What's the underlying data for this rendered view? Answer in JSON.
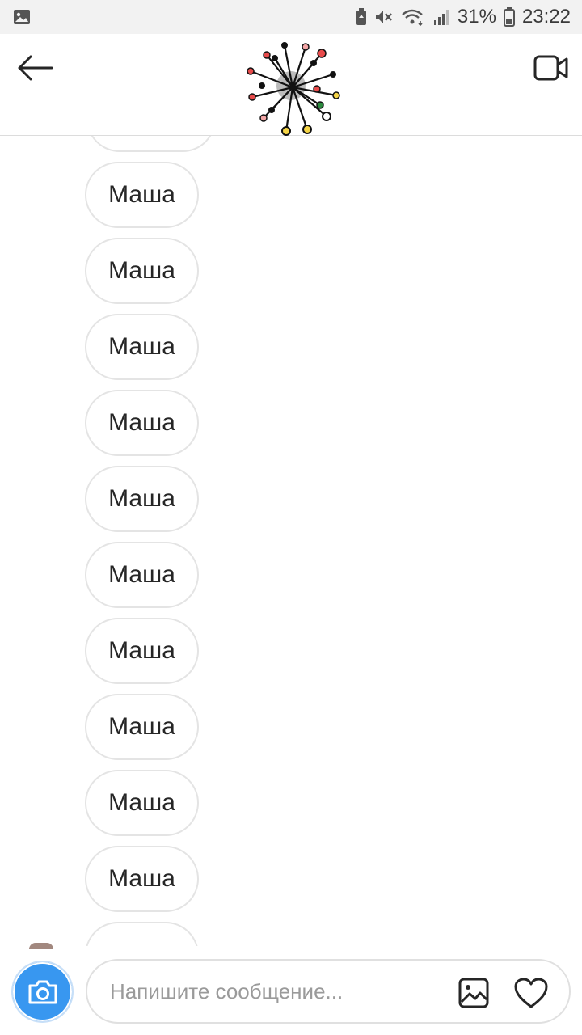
{
  "status_bar": {
    "battery_percent": "31%",
    "time": "23:22",
    "icons": [
      "gallery-notification-icon",
      "battery-saver-icon",
      "mute-icon",
      "wifi-icon",
      "signal-icon",
      "battery-icon"
    ]
  },
  "header": {
    "back_icon": "arrow-left-icon",
    "video_icon": "video-camera-icon"
  },
  "messages": {
    "items": [
      {
        "text": ""
      },
      {
        "text": "Маша"
      },
      {
        "text": "Маша"
      },
      {
        "text": "Маша"
      },
      {
        "text": "Маша"
      },
      {
        "text": "Маша"
      },
      {
        "text": "Маша"
      },
      {
        "text": "Маша"
      },
      {
        "text": "Маша"
      },
      {
        "text": "Маша"
      },
      {
        "text": "Маша"
      },
      {
        "text": ""
      }
    ]
  },
  "composer": {
    "placeholder": "Напишите сообщение...",
    "camera_icon": "camera-icon",
    "gallery_icon": "image-icon",
    "like_icon": "heart-icon"
  },
  "colors": {
    "accent": "#3897f0",
    "bubble_border": "#e4e4e4",
    "text": "#262626"
  }
}
